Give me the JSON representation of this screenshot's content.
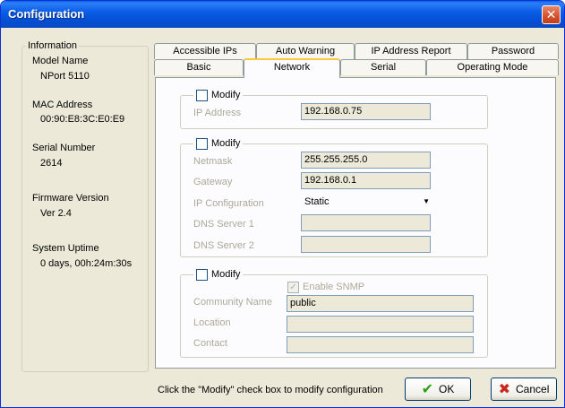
{
  "window": {
    "title": "Configuration",
    "close_glyph": "✕"
  },
  "info": {
    "group_title": "Information",
    "model_name_label": "Model Name",
    "model_name": "NPort 5110",
    "mac_label": "MAC Address",
    "mac": "00:90:E8:3C:E0:E9",
    "serial_label": "Serial Number",
    "serial": "2614",
    "firmware_label": "Firmware Version",
    "firmware": "Ver 2.4",
    "uptime_label": "System Uptime",
    "uptime": "0 days, 00h:24m:30s"
  },
  "tabs": {
    "row1": [
      "Accessible IPs",
      "Auto Warning",
      "IP Address Report",
      "Password"
    ],
    "row2": [
      "Basic",
      "Network",
      "Serial",
      "Operating Mode"
    ],
    "active": "Network"
  },
  "ip_section": {
    "modify_label": "Modify",
    "ip_address_label": "IP Address",
    "ip_address": "192.168.0.75"
  },
  "net_section": {
    "modify_label": "Modify",
    "netmask_label": "Netmask",
    "netmask": "255.255.255.0",
    "gateway_label": "Gateway",
    "gateway": "192.168.0.1",
    "ip_config_label": "IP Configuration",
    "ip_config": "Static",
    "dns1_label": "DNS Server 1",
    "dns1": "",
    "dns2_label": "DNS Server 2",
    "dns2": ""
  },
  "snmp_section": {
    "modify_label": "Modify",
    "enable_snmp_label": "Enable SNMP",
    "community_label": "Community Name",
    "community": "public",
    "location_label": "Location",
    "location": "",
    "contact_label": "Contact",
    "contact": ""
  },
  "footer": {
    "hint": "Click the \"Modify\" check box to modify configuration",
    "ok_label": "OK",
    "cancel_label": "Cancel"
  },
  "colors": {
    "title_bar": "#0550d6",
    "ok_icon": "#2e9e1a",
    "cancel_icon": "#c8281e",
    "tab_highlight": "#ffc83c"
  }
}
